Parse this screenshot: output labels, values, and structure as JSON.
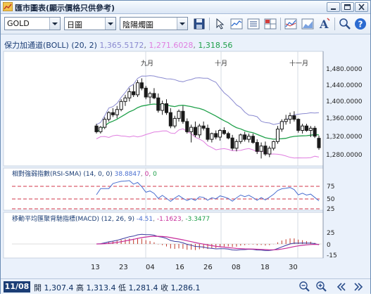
{
  "window": {
    "title": "匯市圖表(顯示價格只供參考)"
  },
  "toolbar": {
    "symbol": "GOLD",
    "period": "日圖",
    "chart_style": "陰陽燭圖"
  },
  "bollinger": {
    "label": "保力加通道(BOLL) (20, 2)",
    "upper": "1,365.5172",
    "lower": "1,271.6028",
    "mid": "1,318.56",
    "color_upper": "#8a8ad0",
    "color_lower": "#e07ee0",
    "color_mid": "#1fa04a"
  },
  "rsi": {
    "label": "相對強弱指數(RSI-SMA) (14, 0, 0)",
    "value": "38.8847",
    "v2": "0",
    "v3": "0",
    "levels": [
      "75",
      "50",
      "25"
    ]
  },
  "macd": {
    "label": "移動平均匯聚背馳指標(MACD) (12, 26, 9)",
    "v1": "-4.51",
    "v2": "-1.1623",
    "v3": "-3.3477",
    "levels": [
      "25",
      "0",
      "-15"
    ]
  },
  "chart": {
    "month_labels": [
      "九月",
      "十月",
      "十一月"
    ],
    "price_ticks": [
      "1,480.0000",
      "1,440.0000",
      "1,400.0000",
      "1,360.0000",
      "1,320.0000",
      "1,280.0000"
    ],
    "x_ticks": [
      "13",
      "23",
      "04",
      "16",
      "26",
      "08",
      "18",
      "30"
    ]
  },
  "status": {
    "date": "11/08",
    "open_label": "開",
    "open": "1,307.4",
    "high_label": "高",
    "high": "1,313.4",
    "low_label": "低",
    "low": "1,281.4",
    "close_label": "收",
    "close": "1,286.1"
  },
  "chart_data": {
    "type": "candlestick",
    "y_range": [
      1250,
      1490
    ],
    "candles": [
      [
        1335,
        1340,
        1318,
        1322
      ],
      [
        1322,
        1335,
        1318,
        1332
      ],
      [
        1332,
        1355,
        1328,
        1350
      ],
      [
        1350,
        1368,
        1345,
        1365
      ],
      [
        1365,
        1375,
        1355,
        1360
      ],
      [
        1360,
        1380,
        1352,
        1372
      ],
      [
        1372,
        1395,
        1368,
        1390
      ],
      [
        1390,
        1405,
        1380,
        1398
      ],
      [
        1398,
        1420,
        1390,
        1412
      ],
      [
        1412,
        1428,
        1400,
        1405
      ],
      [
        1405,
        1438,
        1400,
        1432
      ],
      [
        1432,
        1442,
        1415,
        1420
      ],
      [
        1420,
        1425,
        1395,
        1400
      ],
      [
        1400,
        1412,
        1385,
        1408
      ],
      [
        1408,
        1420,
        1395,
        1398
      ],
      [
        1398,
        1408,
        1365,
        1370
      ],
      [
        1370,
        1392,
        1360,
        1385
      ],
      [
        1385,
        1395,
        1360,
        1365
      ],
      [
        1365,
        1375,
        1330,
        1335
      ],
      [
        1335,
        1358,
        1330,
        1352
      ],
      [
        1352,
        1372,
        1345,
        1368
      ],
      [
        1368,
        1380,
        1340,
        1345
      ],
      [
        1345,
        1352,
        1318,
        1322
      ],
      [
        1322,
        1338,
        1298,
        1332
      ],
      [
        1332,
        1345,
        1310,
        1315
      ],
      [
        1315,
        1340,
        1308,
        1335
      ],
      [
        1335,
        1345,
        1325,
        1330
      ],
      [
        1330,
        1338,
        1300,
        1305
      ],
      [
        1305,
        1320,
        1298,
        1318
      ],
      [
        1318,
        1325,
        1305,
        1310
      ],
      [
        1310,
        1328,
        1302,
        1325
      ],
      [
        1325,
        1332,
        1315,
        1318
      ],
      [
        1318,
        1322,
        1305,
        1308
      ],
      [
        1308,
        1315,
        1280,
        1285
      ],
      [
        1285,
        1305,
        1278,
        1300
      ],
      [
        1300,
        1318,
        1295,
        1315
      ],
      [
        1315,
        1322,
        1300,
        1305
      ],
      [
        1305,
        1318,
        1298,
        1312
      ],
      [
        1312,
        1318,
        1295,
        1298
      ],
      [
        1298,
        1305,
        1272,
        1278
      ],
      [
        1278,
        1298,
        1262,
        1290
      ],
      [
        1290,
        1300,
        1268,
        1272
      ],
      [
        1272,
        1290,
        1265,
        1285
      ],
      [
        1285,
        1302,
        1280,
        1300
      ],
      [
        1300,
        1335,
        1295,
        1328
      ],
      [
        1328,
        1350,
        1322,
        1345
      ],
      [
        1345,
        1360,
        1338,
        1350
      ],
      [
        1350,
        1365,
        1340,
        1358
      ],
      [
        1358,
        1368,
        1345,
        1350
      ],
      [
        1350,
        1352,
        1320,
        1325
      ],
      [
        1325,
        1340,
        1318,
        1335
      ],
      [
        1335,
        1340,
        1322,
        1325
      ],
      [
        1325,
        1335,
        1310,
        1330
      ],
      [
        1330,
        1335,
        1308,
        1312
      ],
      [
        1307.4,
        1313.4,
        1281.4,
        1286.1
      ]
    ]
  }
}
